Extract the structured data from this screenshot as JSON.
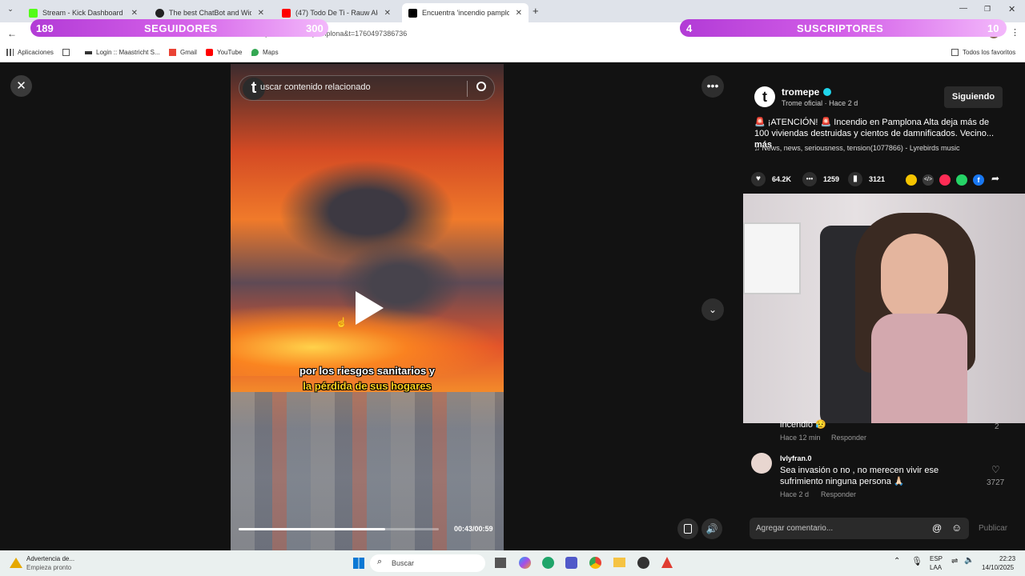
{
  "browser": {
    "tabs": [
      {
        "label": "Stream - Kick Dashboard",
        "color": "#53fc18"
      },
      {
        "label": "The best ChatBot and Widgets",
        "color": "#222222"
      },
      {
        "label": "(47) Todo De Ti - Rauw Alejandro",
        "color": "#ff0000"
      },
      {
        "label": "Encuentra 'incendio pamplona",
        "color": "#000000"
      }
    ],
    "address": "454317990587q=incendio%20pamplona&t=1760497386736",
    "bookmarks": [
      "Aplicaciones",
      "Login :: Maastricht S...",
      "Gmail",
      "YouTube",
      "Maps"
    ],
    "all_favorites": "Todos los favoritos"
  },
  "overlay": {
    "left_count": "189",
    "left_label": "SEGUIDORES",
    "left_goal": "300",
    "right_count": "4",
    "right_label": "SUSCRIPTORES",
    "right_goal": "10"
  },
  "video": {
    "search_placeholder": "uscar contenido relacionado",
    "caption_line1": "por los riesgos sanitarios y",
    "caption_line2": "la pérdida de sus hogares",
    "time": "00:43/00:59",
    "progress": 0.73
  },
  "post": {
    "author": "tromepe",
    "author_sub": "Trome oficial · Hace 2 d",
    "follow_label": "Siguiendo",
    "description": "🚨 ¡ATENCIÓN! 🚨 Incendio en Pamplona Alta deja más de 100 viviendas destruidas y cientos de damnificados. Vecino...",
    "more": "más",
    "music": "News, news, seriousness, tension(1077866) - Lyrebirds music",
    "likes": "64.2K",
    "comments": "1259",
    "saves": "3121"
  },
  "comments": [
    {
      "user": "",
      "text": "incendio 😥",
      "meta": "Hace 12 min",
      "reply": "Responder",
      "likes": "2"
    },
    {
      "user": "lvlyfran.0",
      "text": "Sea invasión o no , no merecen vivir ese sufrimiento ninguna persona 🙏🏻",
      "meta": "Hace 2 d",
      "reply": "Responder",
      "likes": "3727"
    }
  ],
  "comment_box": {
    "placeholder": "Agregar comentario...",
    "publish": "Publicar"
  },
  "taskbar": {
    "notice_title": "Advertencia de...",
    "notice_sub": "Empieza pronto",
    "search": "Buscar",
    "lang1": "ESP",
    "lang2": "LAA",
    "time": "22:23",
    "date": "14/10/2025"
  }
}
